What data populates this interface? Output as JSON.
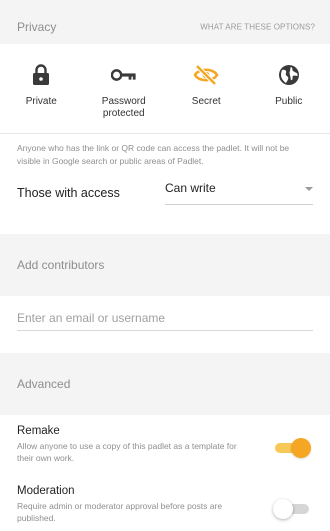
{
  "privacy": {
    "title": "Privacy",
    "help_link": "WHAT ARE THESE OPTIONS?",
    "accent_color": "#f5a623",
    "options": [
      {
        "label": "Private",
        "icon": "lock-icon",
        "selected": false
      },
      {
        "label": "Password protected",
        "icon": "key-icon",
        "selected": false
      },
      {
        "label": "Secret",
        "icon": "eye-off-icon",
        "selected": true
      },
      {
        "label": "Public",
        "icon": "globe-icon",
        "selected": false
      }
    ],
    "description": "Anyone who has the link or QR code can access the padlet. It will not be visible in Google search or public areas of Padlet."
  },
  "access": {
    "label": "Those with access",
    "value": "Can write"
  },
  "contributors": {
    "title": "Add contributors",
    "placeholder": "Enter an email or username"
  },
  "advanced": {
    "title": "Advanced",
    "remake": {
      "title": "Remake",
      "description": "Allow anyone to use a copy of this padlet as a template for their own work.",
      "enabled": true
    },
    "moderation": {
      "title": "Moderation",
      "description": "Require admin or moderator approval before posts are published.",
      "enabled": false
    }
  }
}
